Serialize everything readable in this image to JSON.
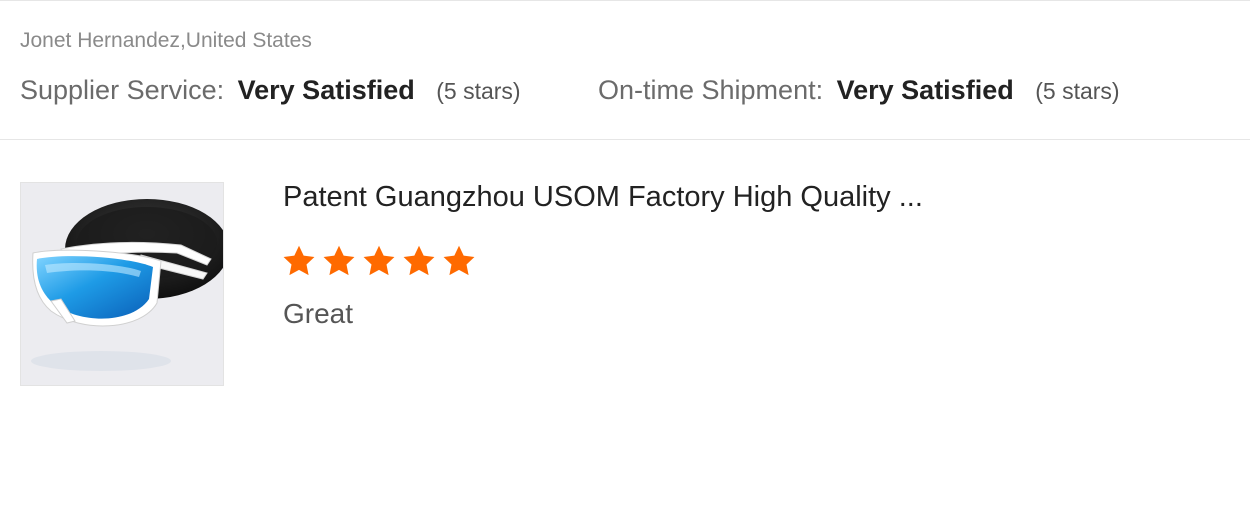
{
  "reviewer": {
    "name_location": "Jonet Hernandez,United States"
  },
  "ratings": {
    "supplier_service": {
      "label": "Supplier Service:",
      "value": "Very Satisfied",
      "stars_text": "(5 stars)"
    },
    "on_time_shipment": {
      "label": "On-time Shipment:",
      "value": "Very Satisfied",
      "stars_text": "(5 stars)"
    }
  },
  "product": {
    "title": "Patent Guangzhou USOM Factory High Quality ...",
    "rating": 5,
    "rating_max": 5,
    "review_text": "Great"
  },
  "colors": {
    "star": "#ff6a00",
    "divider": "#e6e6e6"
  },
  "icons": {
    "star": "star-icon"
  }
}
